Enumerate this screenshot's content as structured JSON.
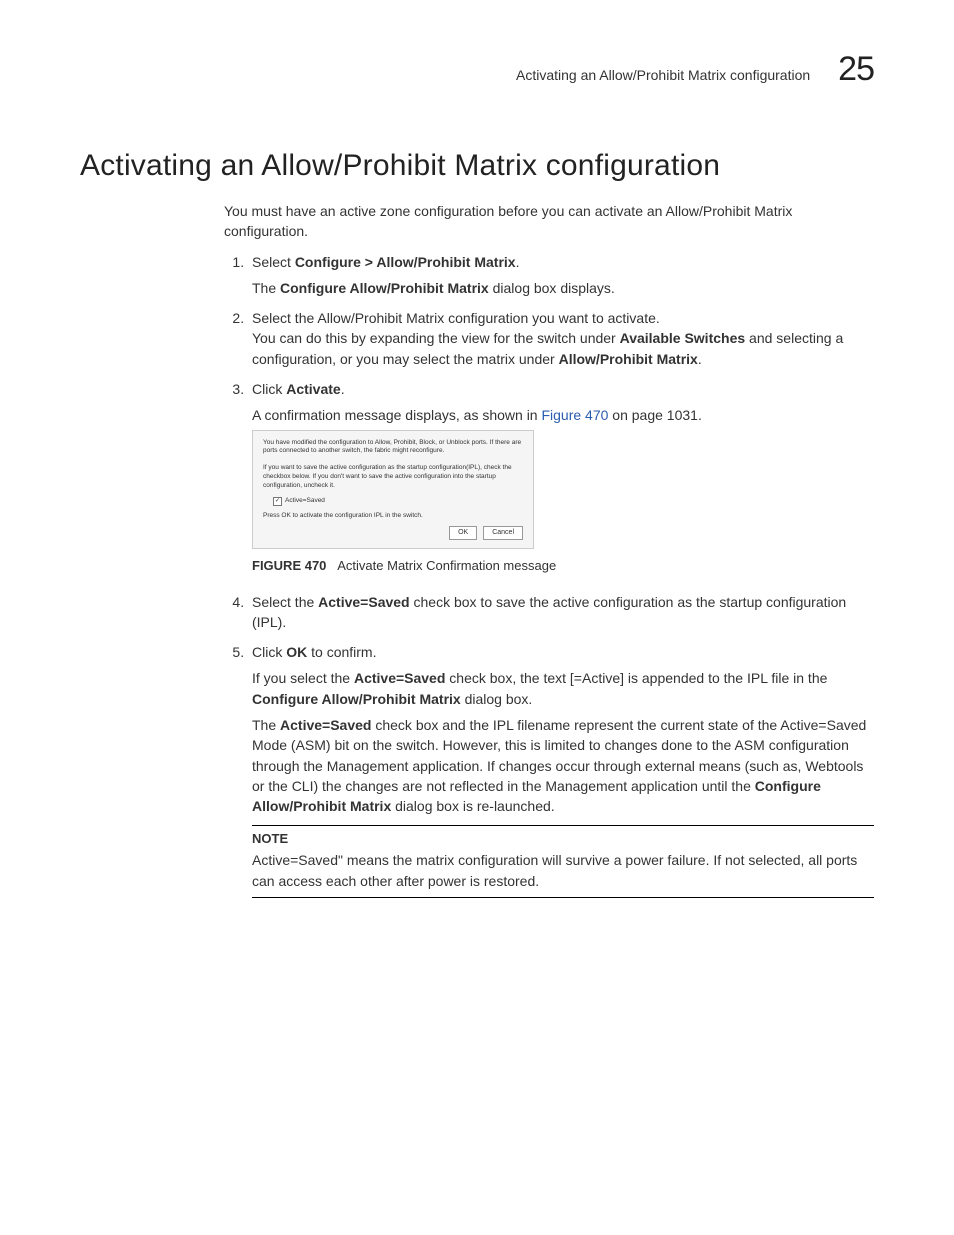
{
  "header": {
    "running_title": "Activating an Allow/Prohibit Matrix configuration",
    "chapter_number": "25"
  },
  "section": {
    "title": "Activating an Allow/Prohibit Matrix configuration"
  },
  "intro": "You must have an active zone configuration before you can activate an Allow/Prohibit Matrix configuration.",
  "steps": {
    "s1_a": "Select ",
    "s1_b": "Configure > Allow/Prohibit Matrix",
    "s1_c": ".",
    "s1_sub_a": "The ",
    "s1_sub_b": "Configure Allow/Prohibit Matrix",
    "s1_sub_c": " dialog box displays.",
    "s2_a": "Select the Allow/Prohibit Matrix configuration you want to activate.",
    "s2_b": "You can do this by expanding the view for the switch under ",
    "s2_c": "Available Switches",
    "s2_d": " and selecting a configuration, or you may select the matrix under ",
    "s2_e": "Allow/Prohibit Matrix",
    "s2_f": ".",
    "s3_a": "Click ",
    "s3_b": "Activate",
    "s3_c": ".",
    "s3_sub_a": "A confirmation message displays, as shown in ",
    "s3_sub_link": "Figure 470",
    "s3_sub_b": " on page 1031.",
    "s4_a": "Select the ",
    "s4_b": "Active=Saved",
    "s4_c": " check box to save the active configuration as the startup configuration (IPL).",
    "s5_a": "Click ",
    "s5_b": "OK",
    "s5_c": " to confirm.",
    "s5_p1_a": "If you select the ",
    "s5_p1_b": "Active=Saved",
    "s5_p1_c": " check box, the text [=Active] is appended to the IPL file in the ",
    "s5_p1_d": "Configure Allow/Prohibit Matrix",
    "s5_p1_e": " dialog box.",
    "s5_p2_a": "The ",
    "s5_p2_b": "Active=Saved",
    "s5_p2_c": " check box and the IPL filename represent the current state of the Active=Saved Mode (ASM) bit on the switch. However, this is limited to changes done to the ASM configuration through the Management application. If changes occur through external means (such as, Webtools or the CLI) the changes are not reflected in the Management application until the ",
    "s5_p2_d": "Configure Allow/Prohibit Matrix",
    "s5_p2_e": " dialog box is re-launched."
  },
  "figure": {
    "line1": "You have modified the configuration to Allow, Prohibit, Block, or Unblock ports. If there are ports connected to another switch, the fabric might reconfigure.",
    "line2": "If you want to save the active configuration as the startup configuration(IPL), check the checkbox below. If you don't want to save the active configuration into the startup configuration, uncheck it.",
    "checkbox_label": "Active=Saved",
    "line3": "Press OK to activate the configuration IPL in the switch.",
    "ok": "OK",
    "cancel": "Cancel",
    "caption_label": "FIGURE 470",
    "caption_text": "Activate Matrix Confirmation message"
  },
  "note": {
    "title": "NOTE",
    "body": "Active=Saved\" means the matrix configuration will survive a power failure. If not selected, all ports can access each other after power is restored."
  }
}
